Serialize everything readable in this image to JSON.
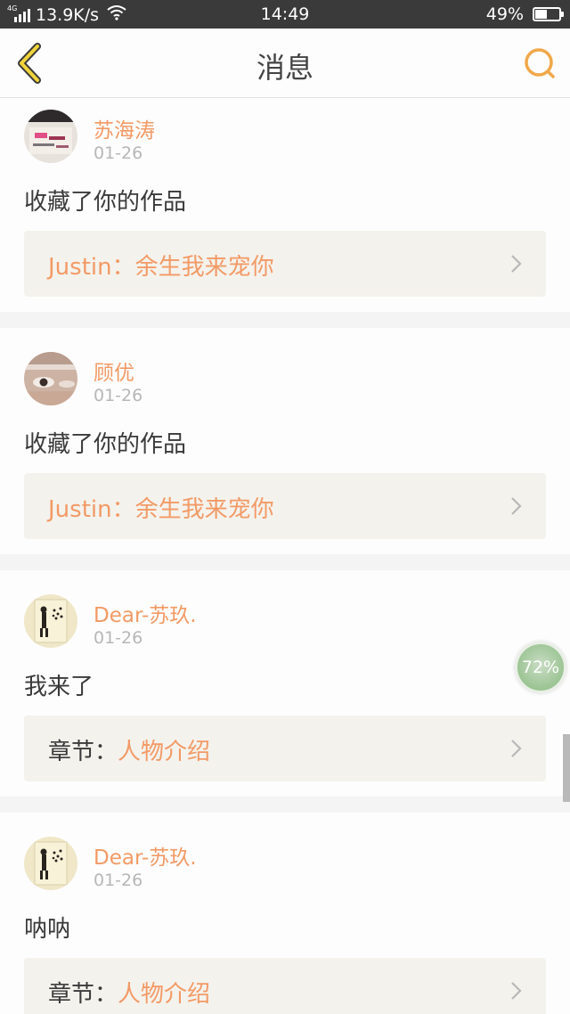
{
  "status_bar": {
    "network_label": "4G",
    "speed": "13.9K/s",
    "time": "14:49",
    "battery": "49%",
    "battery_level": 0.49
  },
  "header": {
    "title": "消息",
    "back_icon": "chevron-left-icon",
    "search_icon": "search-icon",
    "accent_color": "#f0a84a"
  },
  "messages": [
    {
      "username": "苏海涛",
      "date": "01-26",
      "text": "收藏了你的作品",
      "ref_prefix": "",
      "ref_title": "Justin：余生我来宠你"
    },
    {
      "username": "顾优",
      "date": "01-26",
      "text": "收藏了你的作品",
      "ref_prefix": "",
      "ref_title": "Justin：余生我来宠你"
    },
    {
      "username": "Dear-苏玖.",
      "date": "01-26",
      "text": "我来了",
      "ref_prefix": "章节：",
      "ref_title": "人物介绍"
    },
    {
      "username": "Dear-苏玖.",
      "date": "01-26",
      "text": "呐呐",
      "ref_prefix": "章节：",
      "ref_title": "人物介绍"
    }
  ],
  "floating_ball": {
    "label": "72%"
  },
  "colors": {
    "username": "#f29a66",
    "date": "#b7b7b7",
    "ref_background": "#f4f2ec",
    "status_bar": "#3a3a3a"
  }
}
